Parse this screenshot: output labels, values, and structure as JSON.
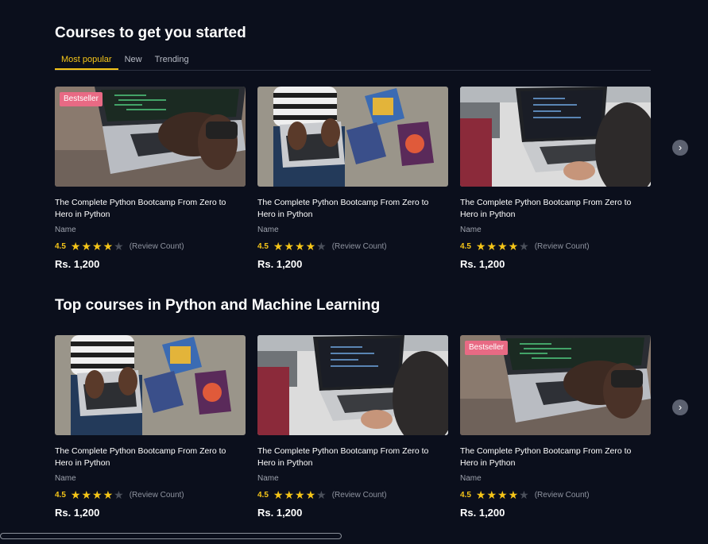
{
  "section1": {
    "title": "Courses to get you started",
    "tabs": [
      "Most popular",
      "New",
      "Trending"
    ],
    "courses": [
      {
        "image": "laptop-hands",
        "bestseller": true,
        "title": "The Complete Python Bootcamp From Zero to Hero in Python",
        "author": "Name",
        "rating": "4.5",
        "reviews": "(Review Count)",
        "price": "Rs. 1,200"
      },
      {
        "image": "books-laptop",
        "bestseller": false,
        "title": "The Complete Python Bootcamp From Zero to Hero in Python",
        "author": "Name",
        "rating": "4.5",
        "reviews": "(Review Count)",
        "price": "Rs. 1,200"
      },
      {
        "image": "office-laptop",
        "bestseller": false,
        "title": "The Complete Python Bootcamp From Zero to Hero in Python",
        "author": "Name",
        "rating": "4.5",
        "reviews": "(Review Count)",
        "price": "Rs. 1,200"
      }
    ]
  },
  "section2": {
    "title": "Top courses in Python and Machine Learning",
    "courses": [
      {
        "image": "books-laptop",
        "bestseller": false,
        "title": "The Complete Python Bootcamp From Zero to Hero in Python",
        "author": "Name",
        "rating": "4.5",
        "reviews": "(Review Count)",
        "price": "Rs. 1,200"
      },
      {
        "image": "office-laptop",
        "bestseller": false,
        "title": "The Complete Python Bootcamp From Zero to Hero in Python",
        "author": "Name",
        "rating": "4.5",
        "reviews": "(Review Count)",
        "price": "Rs. 1,200"
      },
      {
        "image": "laptop-hands",
        "bestseller": true,
        "title": "The Complete Python Bootcamp From Zero to Hero in Python",
        "author": "Name",
        "rating": "4.5",
        "reviews": "(Review Count)",
        "price": "Rs. 1,200"
      }
    ]
  },
  "badge_label": "Bestseller",
  "star_rating": 4,
  "icons": {
    "next": "chevron-right-icon",
    "star": "star-icon"
  },
  "colors": {
    "background": "#0b0f1c",
    "accent": "#f5c518",
    "badge": "#e86a84"
  }
}
